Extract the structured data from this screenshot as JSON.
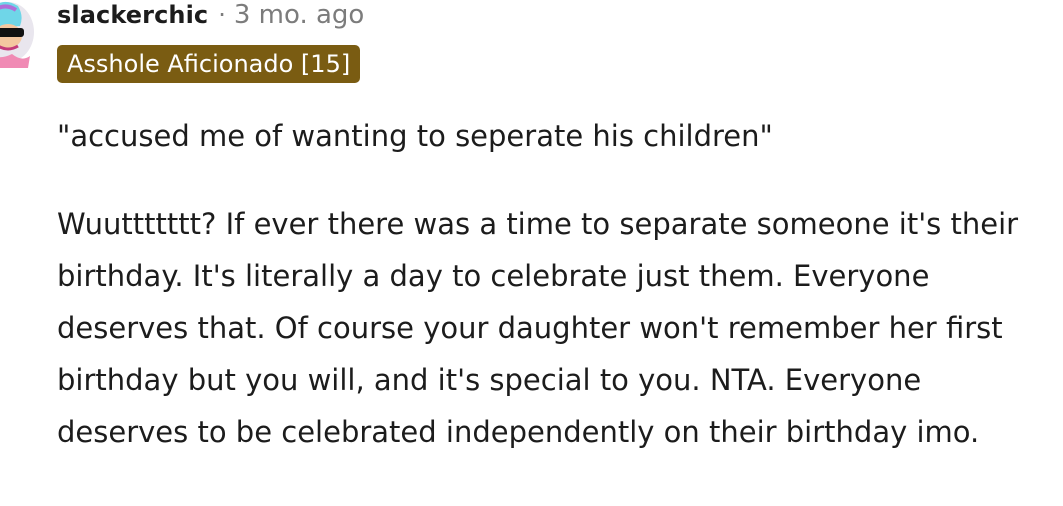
{
  "comment": {
    "username": "slackerchic",
    "separator": "·",
    "timestamp": "3 mo. ago",
    "flair": "Asshole Aficionado [15]",
    "paragraphs": [
      "\"accused me of wanting to seperate his children\"",
      "Wuuttttttt? If ever there was a time to separate someone it's their birthday. It's literally a day to celebrate just them. Everyone deserves that. Of course your daughter won't remember her first birthday but you will, and it's special to you. NTA. Everyone deserves to be celebrated independently on their birthday imo."
    ]
  },
  "colors": {
    "flair_background": "#7a5c12",
    "flair_text": "#ffffff",
    "meta_text": "#7c7c7c",
    "body_text": "#1c1c1c"
  },
  "icons": {
    "avatar": "avatar-icon"
  }
}
